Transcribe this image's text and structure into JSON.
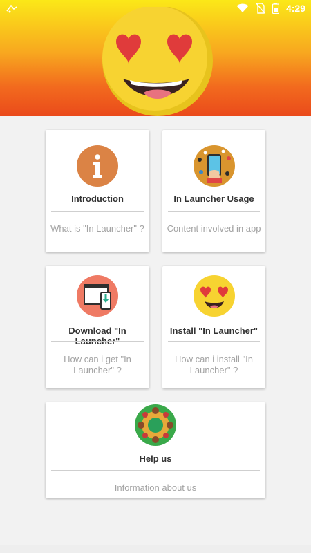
{
  "status_bar": {
    "time": "4:29",
    "icons": [
      "notification-icon",
      "wifi-icon",
      "no-sim-icon",
      "battery-icon"
    ]
  },
  "header": {
    "hero_icon": "heart-eyes-emoji-icon",
    "colors": {
      "top": "#fbe818",
      "bottom": "#ea4a1b"
    }
  },
  "cards": [
    {
      "title": "Introduction",
      "description": "What is \"In Launcher\" ?",
      "icon": "info-icon"
    },
    {
      "title": "In Launcher Usage",
      "description": "Content involved in app",
      "icon": "phone-apps-icon"
    },
    {
      "title": "Download \"In Launcher\"",
      "description": "How can i get \"In Launcher\" ?",
      "icon": "download-icon"
    },
    {
      "title": "Install \"In Launcher\"",
      "description": "How can i install \"In Launcher\" ?",
      "icon": "heart-eyes-emoji-icon"
    },
    {
      "title": "Help us",
      "description": "Information about us",
      "icon": "team-table-icon"
    }
  ]
}
